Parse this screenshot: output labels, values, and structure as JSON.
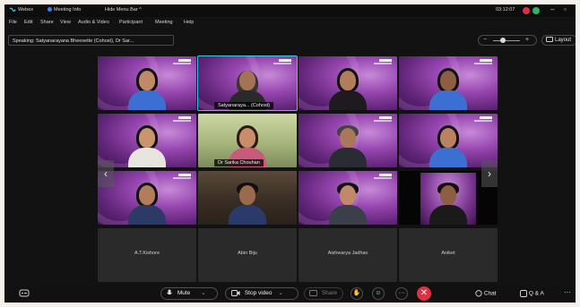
{
  "titlebar": {
    "app_name": "Webex",
    "meeting_info": "Meeting Info",
    "hide_menu_bar": "Hide Menu Bar ^",
    "time": "03:12:07",
    "minimize": "–",
    "restore": "▫"
  },
  "menubar": [
    "File",
    "Edit",
    "Share",
    "View",
    "Audio & Video",
    "Participant",
    "Meeting",
    "Help"
  ],
  "speaking_bar": {
    "speaking_label": "Speaking: Satyanarayana Bheesette (Cohost), Dr Sar..."
  },
  "view_controls": {
    "zoom_minus": "−",
    "zoom_plus": "+",
    "layout_label": "Layout"
  },
  "participants": [
    {
      "name": "",
      "kind": "video"
    },
    {
      "name": "Satyanaraya... (Cohost)",
      "kind": "video"
    },
    {
      "name": "",
      "kind": "video"
    },
    {
      "name": "",
      "kind": "video"
    },
    {
      "name": "",
      "kind": "video"
    },
    {
      "name": "Dr Sarika Chouhan",
      "kind": "video"
    },
    {
      "name": "",
      "kind": "video"
    },
    {
      "name": "",
      "kind": "video"
    },
    {
      "name": "",
      "kind": "video"
    },
    {
      "name": "",
      "kind": "video"
    },
    {
      "name": "",
      "kind": "video"
    },
    {
      "name": "",
      "kind": "video"
    },
    {
      "name": "A.T.Kishore",
      "kind": "no-video"
    },
    {
      "name": "Abin Biju",
      "kind": "no-video"
    },
    {
      "name": "Aishwarya Jadhav",
      "kind": "no-video"
    },
    {
      "name": "Aniket",
      "kind": "no-video"
    }
  ],
  "nav": {
    "prev": "‹",
    "next": "›"
  },
  "bottom_bar": {
    "captions_icon": "captions-icon",
    "mute_label": "Mute",
    "stop_video_label": "Stop video",
    "share_label": "Share",
    "chat_label": "Chat",
    "qa_label": "Q & A",
    "more_label": "···"
  },
  "colors": {
    "end_call": "#e0303f",
    "active_speaker_outline": "#3fc7e6",
    "tile_purple": "#9747b0"
  }
}
